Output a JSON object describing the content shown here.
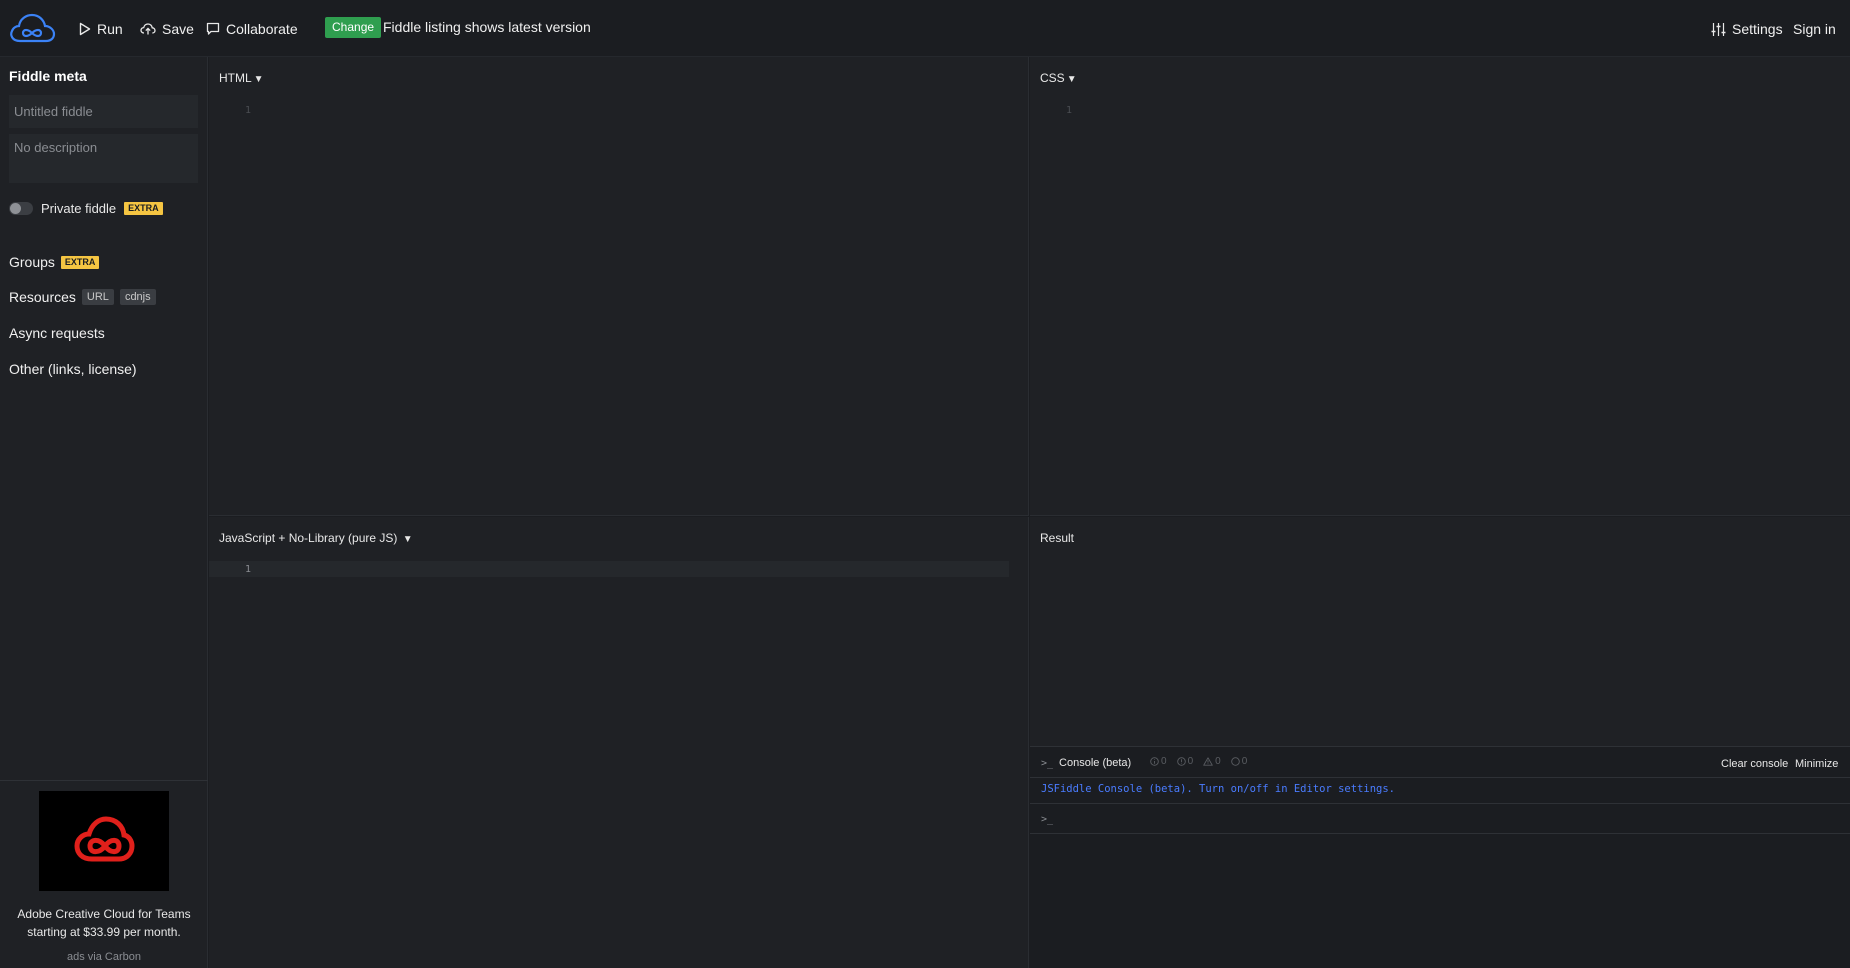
{
  "topbar": {
    "run_label": "Run",
    "save_label": "Save",
    "collaborate_label": "Collaborate",
    "change_badge": "Change",
    "notice": "Fiddle listing shows latest version",
    "settings_label": "Settings",
    "signin_label": "Sign in"
  },
  "sidebar": {
    "title": "Fiddle meta",
    "title_placeholder": "Untitled fiddle",
    "description_placeholder": "No description",
    "private_label": "Private fiddle",
    "extra_badge": "EXTRA",
    "groups_label": "Groups",
    "resources_label": "Resources",
    "resources_tags": [
      "URL",
      "cdnjs"
    ],
    "async_label": "Async requests",
    "other_label": "Other (links, license)",
    "private_enabled": false
  },
  "ad": {
    "text": "Adobe Creative Cloud for Teams starting at $33.99 per month.",
    "via": "ads via Carbon"
  },
  "panels": {
    "html_title": "HTML",
    "css_title": "CSS",
    "js_title": "JavaScript + No-Library (pure JS)",
    "result_title": "Result",
    "line_number": "1"
  },
  "console": {
    "prompt": ">_",
    "title": "Console (beta)",
    "counters": [
      "0",
      "0",
      "0",
      "0"
    ],
    "clear_label": "Clear console",
    "minimize_label": "Minimize",
    "message": "JSFiddle Console (beta). Turn on/off in Editor settings."
  },
  "colors": {
    "background": "#1b1d21",
    "panel": "#1f2125",
    "accent_green": "#2f9e4f",
    "extra_yellow": "#f5c542",
    "console_blue": "#4a7cff",
    "logo_blue": "#3b82f6",
    "ad_red": "#e0201b"
  }
}
